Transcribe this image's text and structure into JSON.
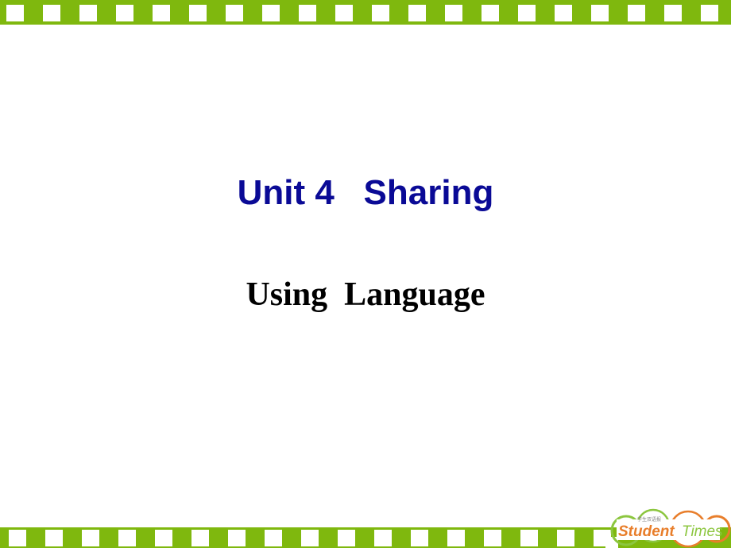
{
  "slide": {
    "title": "Unit 4   Sharing",
    "subtitle": "Using  Language"
  },
  "logo": {
    "name": "Student Times",
    "word1": "Student",
    "word2": "Times",
    "tagline": "学生双语报",
    "colors": {
      "green": "#8cc63f",
      "orange": "#e87e2b"
    }
  },
  "theme": {
    "strip_color": "#7fb80e",
    "title_color": "#0a0a96"
  }
}
